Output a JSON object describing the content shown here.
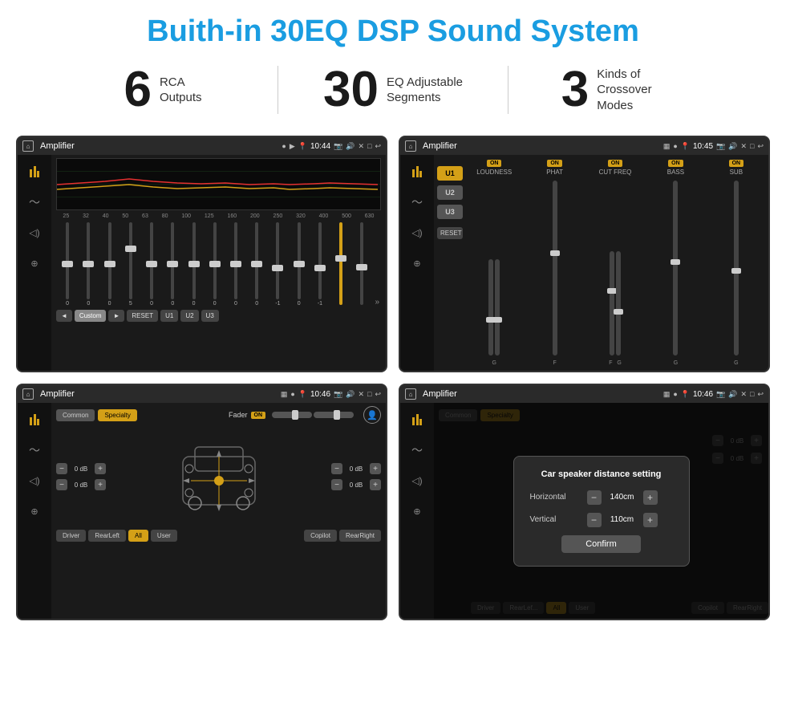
{
  "page": {
    "title": "Buith-in 30EQ DSP Sound System",
    "stats": [
      {
        "number": "6",
        "label": "RCA\nOutputs"
      },
      {
        "number": "30",
        "label": "EQ Adjustable\nSegments"
      },
      {
        "number": "3",
        "label": "Kinds of\nCrossover Modes"
      }
    ]
  },
  "screens": [
    {
      "id": "screen1",
      "topbar": {
        "title": "Amplifier",
        "time": "10:44"
      },
      "type": "eq",
      "eq_labels": [
        "25",
        "32",
        "40",
        "50",
        "63",
        "80",
        "100",
        "125",
        "160",
        "200",
        "250",
        "320",
        "400",
        "500",
        "630"
      ],
      "eq_values": [
        "0",
        "0",
        "0",
        "5",
        "0",
        "0",
        "0",
        "0",
        "0",
        "0",
        "-1",
        "0",
        "-1",
        "",
        ""
      ],
      "buttons": [
        "◄",
        "Custom",
        "►",
        "RESET",
        "U1",
        "U2",
        "U3"
      ]
    },
    {
      "id": "screen2",
      "topbar": {
        "title": "Amplifier",
        "time": "10:45"
      },
      "type": "amplifier",
      "u_buttons": [
        "U1",
        "U2",
        "U3"
      ],
      "columns": [
        {
          "on": true,
          "label": "LOUDNESS",
          "values": []
        },
        {
          "on": true,
          "label": "PHAT",
          "values": []
        },
        {
          "on": true,
          "label": "CUT FREQ",
          "values": []
        },
        {
          "on": true,
          "label": "BASS",
          "values": []
        },
        {
          "on": true,
          "label": "SUB",
          "values": []
        }
      ]
    },
    {
      "id": "screen3",
      "topbar": {
        "title": "Amplifier",
        "time": "10:46"
      },
      "type": "fader",
      "tabs": [
        "Common",
        "Specialty"
      ],
      "active_tab": "Specialty",
      "fader_label": "Fader",
      "on_status": "ON",
      "left_db_values": [
        "0 dB",
        "0 dB"
      ],
      "right_db_values": [
        "0 dB",
        "0 dB"
      ],
      "bottom_buttons": [
        "Driver",
        "RearLeft",
        "All",
        "User",
        "Copilot",
        "RearRight"
      ]
    },
    {
      "id": "screen4",
      "topbar": {
        "title": "Amplifier",
        "time": "10:46"
      },
      "type": "dialog",
      "tabs": [
        "Common",
        "Specialty"
      ],
      "dialog": {
        "title": "Car speaker distance setting",
        "horizontal_label": "Horizontal",
        "horizontal_value": "140cm",
        "vertical_label": "Vertical",
        "vertical_value": "110cm",
        "confirm_label": "Confirm",
        "right_db_values": [
          "0 dB",
          "0 dB"
        ]
      },
      "bottom_buttons": [
        "Driver",
        "RearLeft",
        "All",
        "User",
        "Copilot",
        "RearRight"
      ]
    }
  ]
}
